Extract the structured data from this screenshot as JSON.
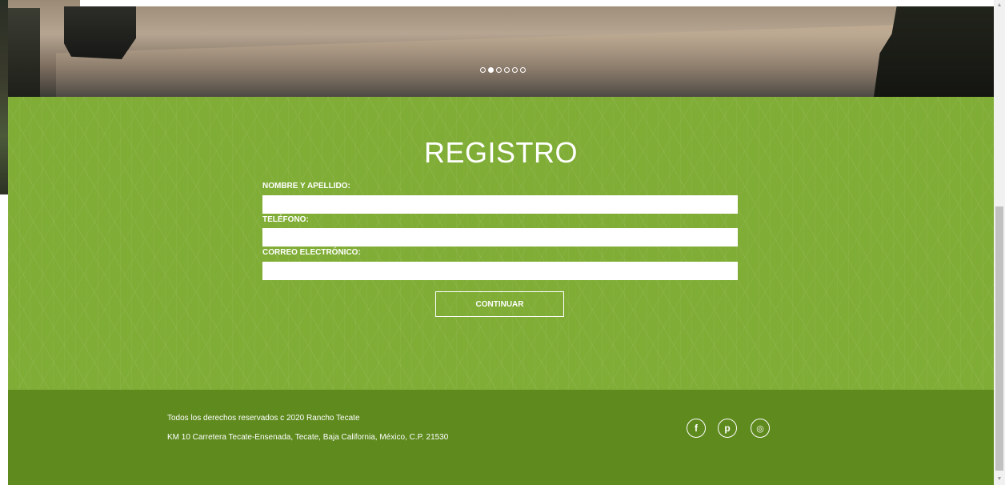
{
  "hero": {
    "slide_count": 6,
    "active_slide": 1
  },
  "registro": {
    "title": "REGISTRO",
    "fields": [
      {
        "label": "NOMBRE Y APELLIDO:",
        "value": "",
        "placeholder": ""
      },
      {
        "label": "TELÉFONO:",
        "value": "",
        "placeholder": ""
      },
      {
        "label": "CORREO ELECTRÓNICO:",
        "value": "",
        "placeholder": ""
      }
    ],
    "submit_label": "CONTINUAR"
  },
  "footer": {
    "copyright": "Todos los derechos reservados c 2020 Rancho Tecate",
    "address": "KM 10 Carretera Tecate-Ensenada, Tecate, Baja California, México, C.P. 21530",
    "social": [
      {
        "icon": "facebook-icon",
        "glyph": "f"
      },
      {
        "icon": "pinterest-icon",
        "glyph": "p"
      },
      {
        "icon": "instagram-icon",
        "glyph": "◎"
      }
    ]
  },
  "colors": {
    "registro_bg": "#80ad36",
    "footer_bg": "#5e8a1e"
  },
  "scrollbar": {
    "up_glyph": "▲",
    "down_glyph": "▼"
  }
}
